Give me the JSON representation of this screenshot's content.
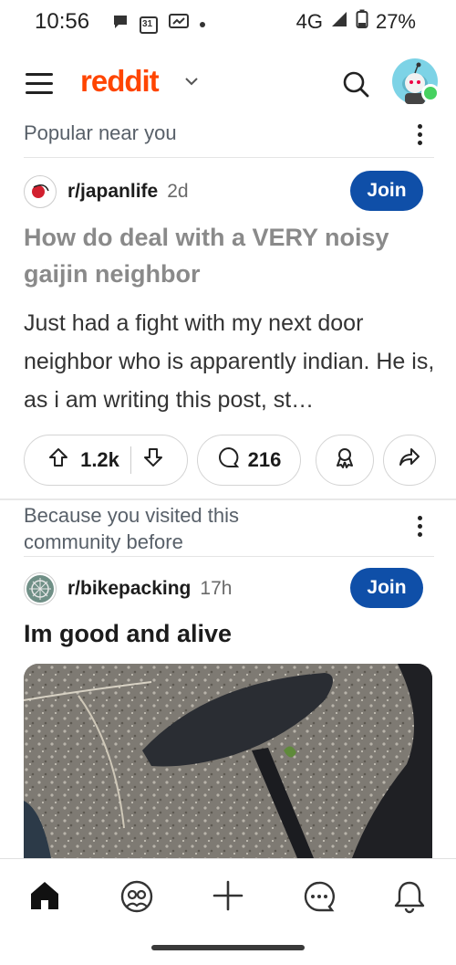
{
  "status_bar": {
    "time": "10:56",
    "calendar_day": "31",
    "network": "4G",
    "battery": "27%"
  },
  "header": {
    "logo": "reddit"
  },
  "feed": {
    "section1": {
      "title": "Popular near you"
    },
    "post1": {
      "community": "r/japanlife",
      "age": "2d",
      "join_label": "Join",
      "title": "How do deal with a VERY noisy gaijin neighbor",
      "body": "Just had a fight with my next door neighbor who is apparently indian. He is, as i am writing this post, st…",
      "votes": "1.2k",
      "comments": "216"
    },
    "section2": {
      "title": "Because you visited this community before"
    },
    "post2": {
      "community": "r/bikepacking",
      "age": "17h",
      "join_label": "Join",
      "title": "Im good and alive"
    }
  },
  "colors": {
    "brand": "#ff4500",
    "join": "#0f4fa8",
    "online": "#46d160"
  }
}
